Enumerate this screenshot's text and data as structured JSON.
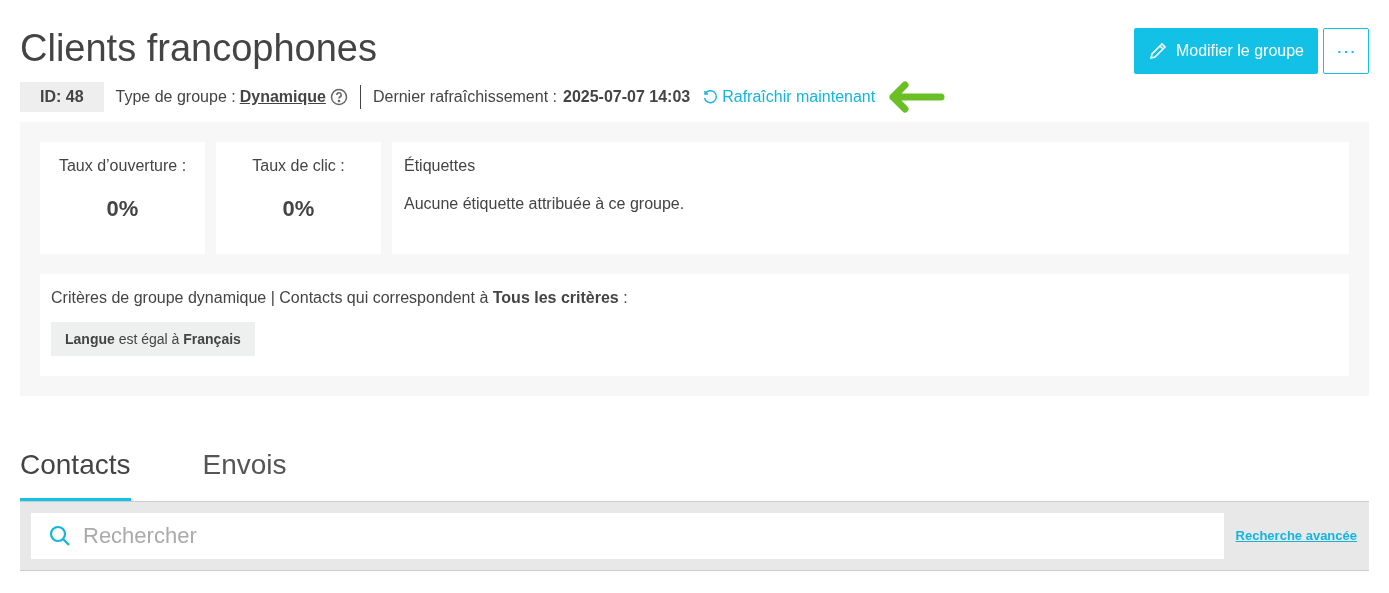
{
  "title": "Clients francophones",
  "actions": {
    "edit_button": "Modifier le groupe",
    "more_button": "⋯"
  },
  "meta": {
    "id": "ID: 48",
    "type_label": "Type de groupe :",
    "type_value": "Dynamique",
    "refresh_label": "Dernier rafraîchissement :",
    "refresh_value": "2025-07-07 14:03",
    "refresh_link": "Rafraîchir maintenant"
  },
  "stats": [
    {
      "label": "Taux d’ouverture :",
      "value": "0%"
    },
    {
      "label": "Taux de clic :",
      "value": "0%"
    }
  ],
  "tags": {
    "title": "Étiquettes",
    "text": "Aucune étiquette attribuée à ce groupe."
  },
  "criteria": {
    "text": "Critères de groupe dynamique | Contacts qui correspondent à **Tous les critères** :",
    "rules": [
      "**Langue** est égal à **Français**"
    ]
  },
  "tabs": [
    {
      "label": "Contacts",
      "selected": true
    },
    {
      "label": "Envois",
      "selected": false
    }
  ],
  "search": {
    "placeholder": "Rechercher",
    "advanced_link": "Recherche avancée"
  }
}
